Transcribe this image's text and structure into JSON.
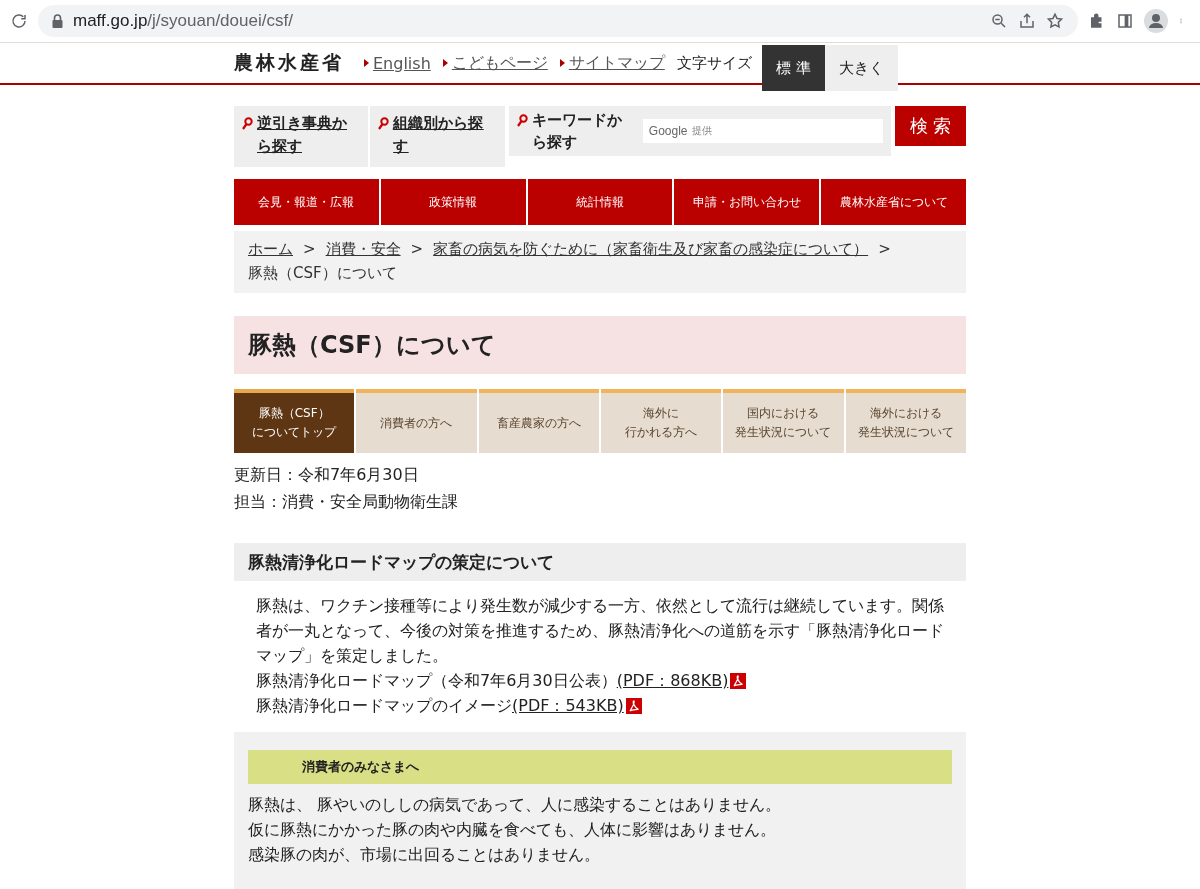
{
  "browser": {
    "url_host": "maff.go.jp",
    "url_path": "/j/syouan/douei/csf/"
  },
  "header": {
    "logo": "農林水産省",
    "links": [
      "English",
      "こどもページ",
      "サイトマップ"
    ],
    "font_size_label": "文字サイズ",
    "font_sizes": [
      {
        "label": "標 準",
        "selected": true
      },
      {
        "label": "大きく",
        "selected": false
      }
    ]
  },
  "search": {
    "links": [
      "逆引き事典から探す",
      "組織別から探す"
    ],
    "keyword_label": "キーワードから探す",
    "google_label": "Google",
    "google_sub": "提供",
    "button": "検 索"
  },
  "nav": [
    "会見・報道・広報",
    "政策情報",
    "統計情報",
    "申請・お問い合わせ",
    "農林水産省について"
  ],
  "breadcrumb": {
    "links": [
      "ホーム",
      "消費・安全",
      "家畜の病気を防ぐために（家畜衛生及び家畜の感染症について）"
    ],
    "current": "豚熱（CSF）について",
    "separator": ">"
  },
  "title": "豚熱（CSF）について",
  "tabs": [
    {
      "lines": [
        "豚熱（CSF）",
        "についてトップ"
      ],
      "selected": true
    },
    {
      "lines": [
        "消費者の方へ"
      ],
      "selected": false
    },
    {
      "lines": [
        "畜産農家の方へ"
      ],
      "selected": false
    },
    {
      "lines": [
        "海外に",
        "行かれる方へ"
      ],
      "selected": false
    },
    {
      "lines": [
        "国内における",
        "発生状況について"
      ],
      "selected": false
    },
    {
      "lines": [
        "海外における",
        "発生状況について"
      ],
      "selected": false
    }
  ],
  "meta": [
    "更新日：令和7年6月30日",
    "担当：消費・安全局動物衛生課"
  ],
  "section": {
    "heading": "豚熱清浄化ロードマップの策定について",
    "paragraph": "豚熱は、ワクチン接種等により発生数が減少する一方、依然として流行は継続しています。関係者が一丸となって、今後の対策を推進するため、豚熱清浄化への道筋を示す「豚熱清浄化ロードマップ」を策定しました。",
    "files": [
      {
        "text": "豚熱清浄化ロードマップ（令和7年6月30日公表）",
        "link": "(PDF：868KB)"
      },
      {
        "text": "豚熱清浄化ロードマップのイメージ",
        "link": "(PDF：543KB)"
      }
    ]
  },
  "consumer": {
    "heading": "消費者のみなさまへ",
    "lines": [
      "豚熱は、 豚やいのししの病気であって、人に感染することはありません。",
      "仮に豚熱にかかった豚の肉や内臓を食べても、人体に影響はありません。",
      "感染豚の肉が、市場に出回ることはありません。"
    ]
  }
}
